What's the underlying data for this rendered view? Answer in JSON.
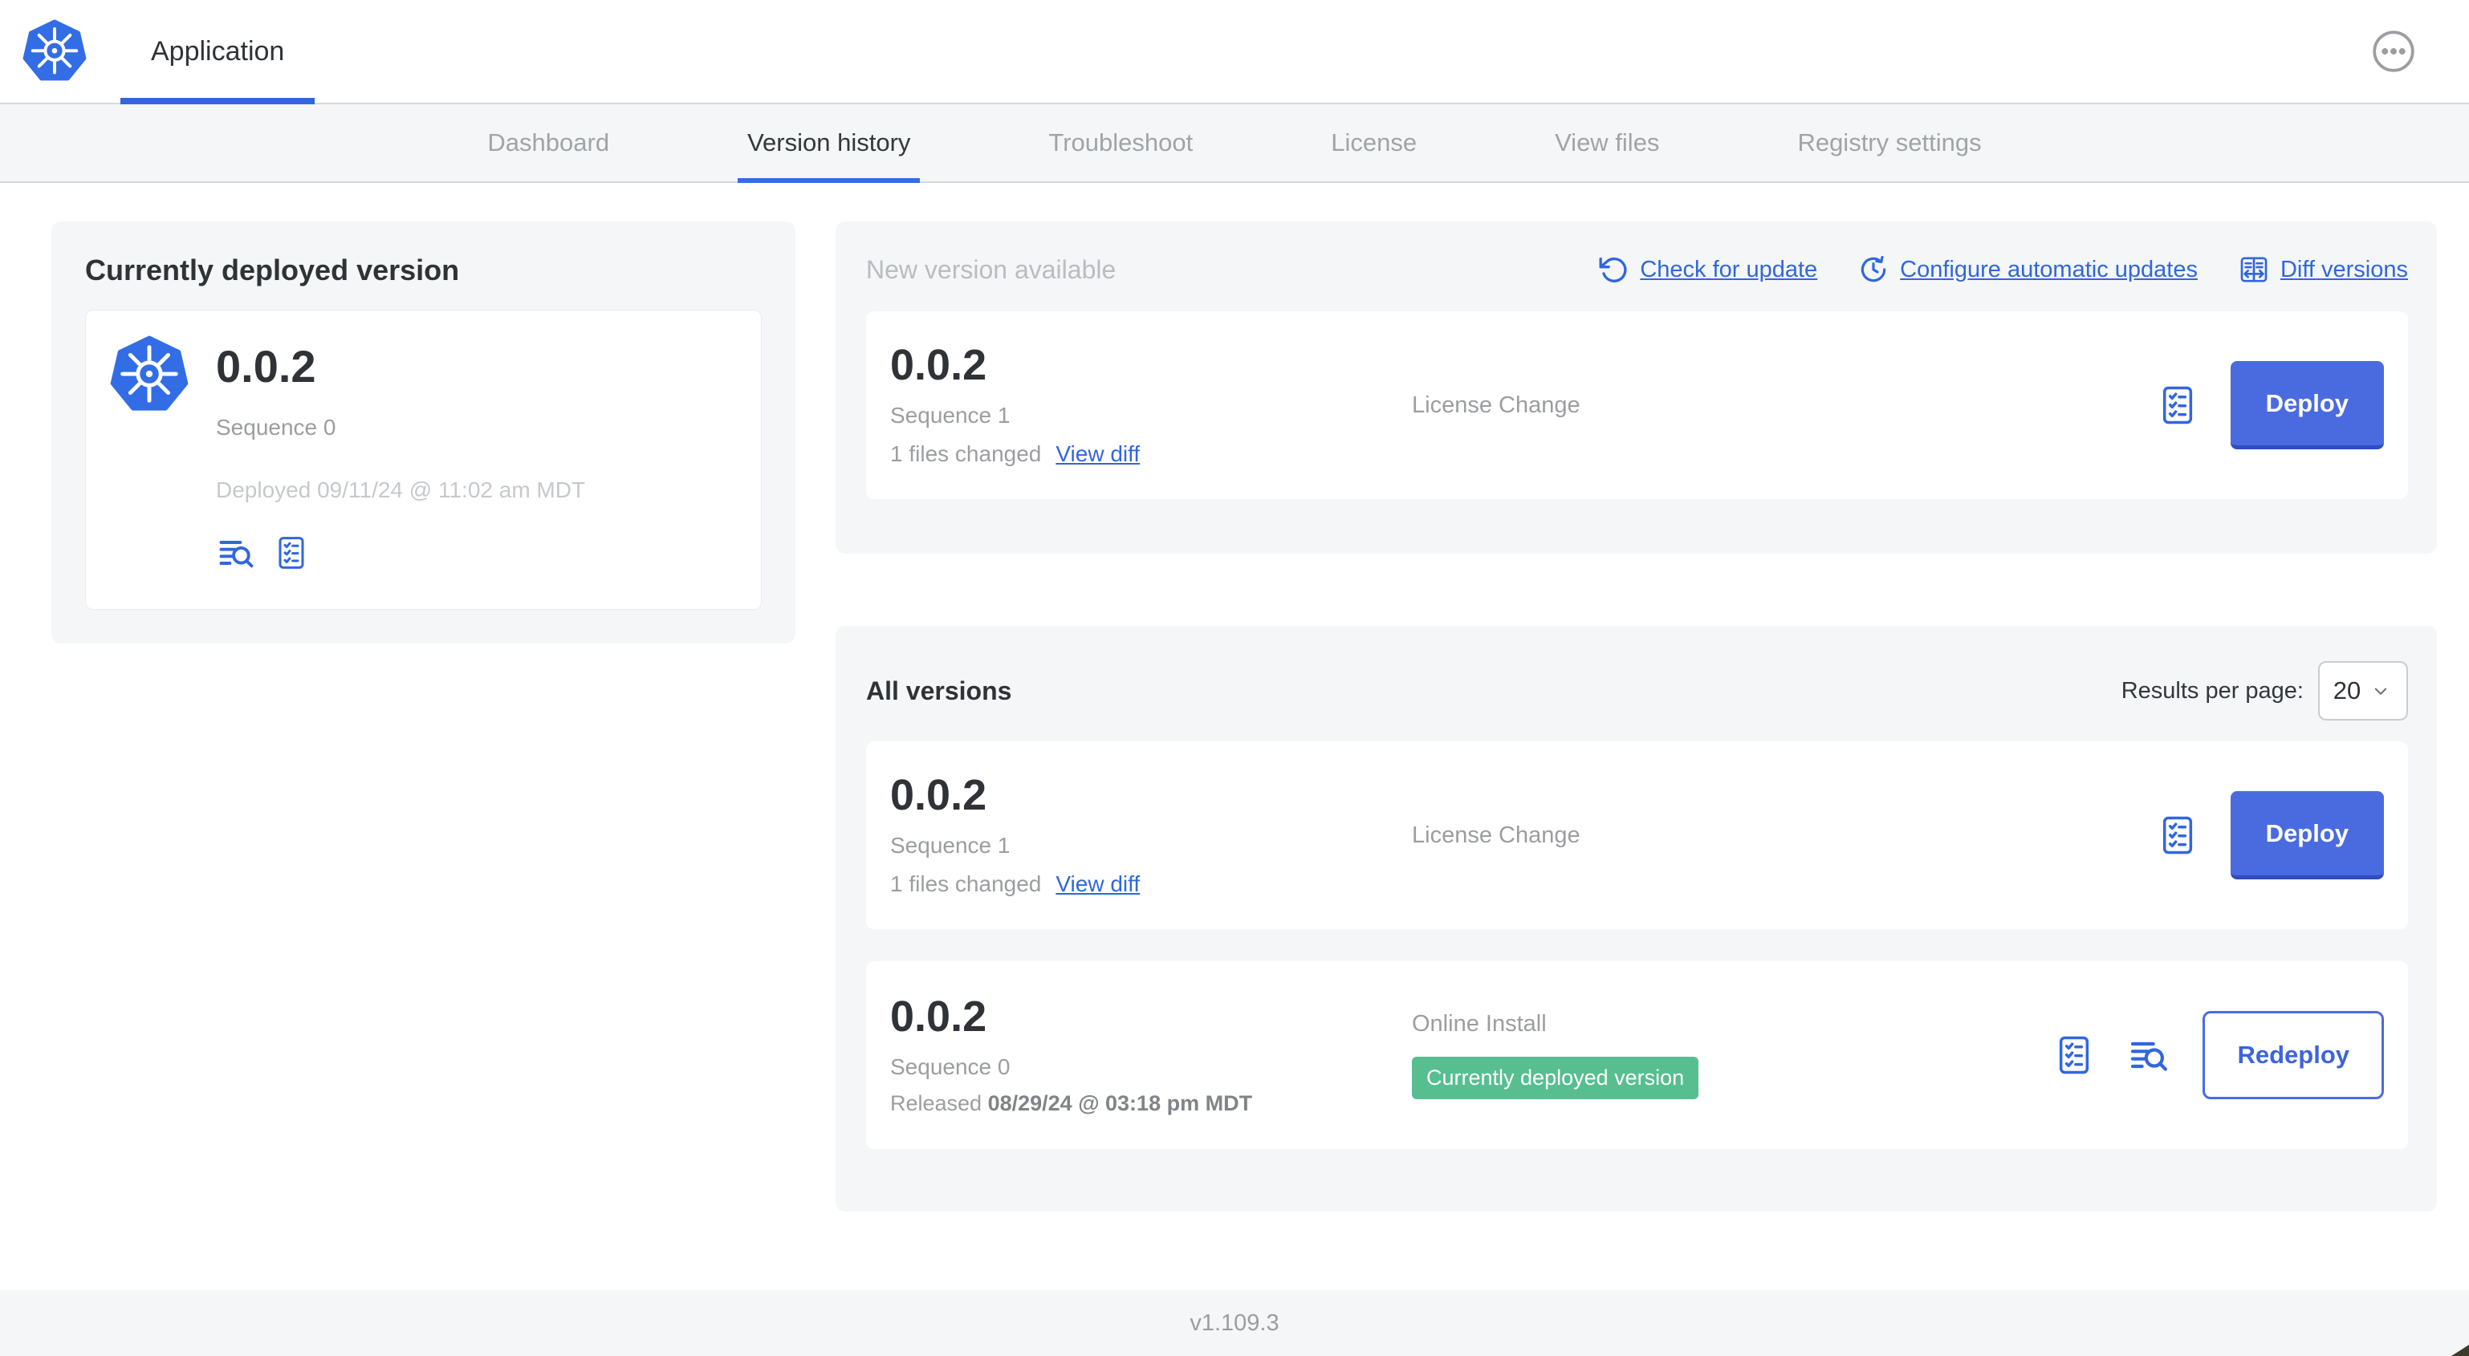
{
  "header": {
    "app_tab_label": "Application",
    "logo_icon": "kubernetes-logo",
    "overflow_menu_icon": "ellipsis-circle-icon"
  },
  "nav": {
    "tabs": [
      {
        "label": "Dashboard",
        "active": false
      },
      {
        "label": "Version history",
        "active": true
      },
      {
        "label": "Troubleshoot",
        "active": false
      },
      {
        "label": "License",
        "active": false
      },
      {
        "label": "View files",
        "active": false
      },
      {
        "label": "Registry settings",
        "active": false
      }
    ]
  },
  "currently_deployed": {
    "title": "Currently deployed version",
    "version": "0.0.2",
    "sequence": "Sequence 0",
    "deployed_at": "Deployed 09/11/24 @ 11:02 am MDT",
    "icons": [
      "deploy-logs-icon",
      "preflight-checks-icon"
    ]
  },
  "new_version": {
    "title": "New version available",
    "actions": [
      {
        "label": "Check for update",
        "icon": "refresh-icon"
      },
      {
        "label": "Configure automatic updates",
        "icon": "scheduled-update-icon"
      },
      {
        "label": "Diff versions",
        "icon": "diff-icon"
      }
    ],
    "row": {
      "version": "0.0.2",
      "sequence": "Sequence 1",
      "files_changed": "1 files changed",
      "view_diff": "View diff",
      "source": "License Change",
      "preflight_icon": "preflight-checks-icon",
      "deploy_button": "Deploy"
    }
  },
  "all_versions": {
    "title": "All versions",
    "results_per_page_label": "Results per page:",
    "results_per_page": "20",
    "rows": [
      {
        "version": "0.0.2",
        "sequence": "Sequence 1",
        "files_changed": "1 files changed",
        "view_diff": "View diff",
        "source": "License Change",
        "preflight_icon": "preflight-checks-icon",
        "deploy_button": "Deploy"
      },
      {
        "version": "0.0.2",
        "sequence": "Sequence 0",
        "released_prefix": "Released",
        "released_date": "08/29/24 @ 03:18 pm MDT",
        "source": "Online Install",
        "badge": "Currently deployed version",
        "icons": [
          "preflight-checks-icon",
          "deploy-logs-icon"
        ],
        "redeploy_button": "Redeploy"
      }
    ]
  },
  "footer": {
    "version": "v1.109.3"
  },
  "colors": {
    "link_blue": "#3066e0",
    "button_blue": "#4a6be0",
    "active_tab_underline": "#326de6",
    "badge_green": "#57be90",
    "panel_gray": "#f4f6f8"
  }
}
